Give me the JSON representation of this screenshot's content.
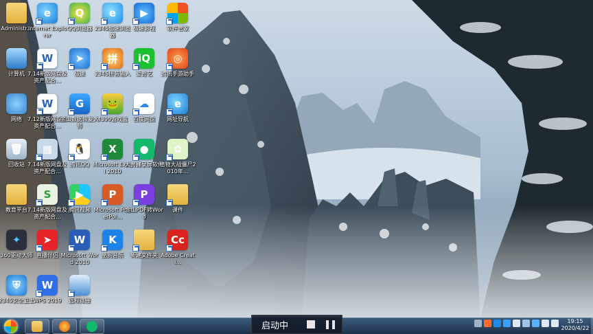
{
  "desktop": {
    "icons": [
      {
        "label": "Administr...",
        "glyph": "",
        "icon": "user-folder-icon",
        "cls": "c-folder"
      },
      {
        "label": "Internet Explorer",
        "glyph": "e",
        "icon": "internet-explorer-icon",
        "cls": "c-ie"
      },
      {
        "label": "QQ浏览器",
        "glyph": "Q",
        "icon": "qq-browser-icon",
        "cls": "c-qqbrowser"
      },
      {
        "label": "2345加速浏览器",
        "glyph": "e",
        "icon": "2345-browser-icon",
        "cls": "c-ie2345"
      },
      {
        "label": "极速影视",
        "glyph": "▶",
        "icon": "video-player-icon",
        "cls": "c-video"
      },
      {
        "label": "软件管家",
        "glyph": "",
        "icon": "software-manager-icon",
        "cls": "c-soft"
      },
      {
        "label": "计算机",
        "glyph": "",
        "icon": "computer-icon",
        "cls": "c-pc"
      },
      {
        "label": "7.14新版网盘及资产配合...",
        "glyph": "W",
        "icon": "word-document-icon",
        "cls": "c-doc"
      },
      {
        "label": "极速",
        "glyph": "➤",
        "icon": "jisu-icon",
        "cls": "c-jisu"
      },
      {
        "label": "2345拼音输入",
        "glyph": "拼",
        "icon": "pinyin-input-icon",
        "cls": "c-pinyin"
      },
      {
        "label": "爱奇艺",
        "glyph": "iQ",
        "icon": "iqiyi-icon",
        "cls": "c-iqiyi"
      },
      {
        "label": "腾讯手游助手",
        "glyph": "◎",
        "icon": "tencent-game-assistant-icon",
        "cls": "c-game"
      },
      {
        "label": "网络",
        "glyph": "",
        "icon": "network-icon",
        "cls": "c-net"
      },
      {
        "label": "7.12新版网盘及资产配合...",
        "glyph": "W",
        "icon": "word-document-icon",
        "cls": "c-doc"
      },
      {
        "label": "金山数据恢复大师",
        "glyph": "G",
        "icon": "jinshan-data-recovery-icon",
        "cls": "c-jinshan"
      },
      {
        "label": "4399游戏盒",
        "glyph": "🐸",
        "icon": "4399-game-box-icon",
        "cls": "c-4399"
      },
      {
        "label": "百度网盘",
        "glyph": "☁",
        "icon": "baidu-netdisk-icon",
        "cls": "c-baidu"
      },
      {
        "label": "网址导航",
        "glyph": "e",
        "icon": "web-navigation-icon",
        "cls": "c-ie"
      },
      {
        "label": "回收站",
        "glyph": "🗑",
        "icon": "recycle-bin-icon",
        "cls": "c-recycle"
      },
      {
        "label": "7.14新版网盘及资产配合...",
        "glyph": "▦",
        "icon": "presentation-file-icon",
        "cls": "c-ppt"
      },
      {
        "label": "腾讯QQ",
        "glyph": "🐧",
        "icon": "tencent-qq-icon",
        "cls": "c-qq"
      },
      {
        "label": "Microsoft Excel 2010",
        "glyph": "X",
        "icon": "excel-icon",
        "cls": "c-excel"
      },
      {
        "label": "大黄蜂录屏软件",
        "glyph": "●",
        "icon": "screen-recorder-icon",
        "cls": "c-lupin"
      },
      {
        "label": "植物大战僵尸2010年...",
        "glyph": "✿",
        "icon": "plants-vs-zombies-icon",
        "cls": "c-plant"
      },
      {
        "label": "教育平台",
        "glyph": "",
        "icon": "folder-icon",
        "cls": "c-edu"
      },
      {
        "label": "7.14新版网盘及资产配合...",
        "glyph": "S",
        "icon": "spreadsheet-file-icon",
        "cls": "c-class"
      },
      {
        "label": "腾讯视频",
        "glyph": "▶",
        "icon": "tencent-video-icon",
        "cls": "c-tencentv"
      },
      {
        "label": "Microsoft PowerPoi...",
        "glyph": "P",
        "icon": "powerpoint-icon",
        "cls": "c-pptx"
      },
      {
        "label": "金山PDF转Word",
        "glyph": "P",
        "icon": "pdf-to-word-icon",
        "cls": "c-pdf"
      },
      {
        "label": "课件",
        "glyph": "",
        "icon": "folder-icon",
        "cls": "c-folder"
      },
      {
        "label": "360驱动大师",
        "glyph": "✦",
        "icon": "360-driver-icon",
        "cls": "c-360"
      },
      {
        "label": "直播伴侣",
        "glyph": "➤",
        "icon": "live-companion-icon",
        "cls": "c-lure"
      },
      {
        "label": "Microsoft Word 2010",
        "glyph": "W",
        "icon": "word-icon",
        "cls": "c-word"
      },
      {
        "label": "酷狗音乐",
        "glyph": "K",
        "icon": "kugou-music-icon",
        "cls": "c-kugou"
      },
      {
        "label": "新建文件夹",
        "glyph": "",
        "icon": "new-folder-icon",
        "cls": "c-newfolder"
      },
      {
        "label": "Adobe Creati...",
        "glyph": "Cc",
        "icon": "adobe-creative-cloud-icon",
        "cls": "c-adobe"
      },
      {
        "label": "2345安全卫士",
        "glyph": "⛨",
        "icon": "2345-security-icon",
        "cls": "c-safe"
      },
      {
        "label": "WPS 2019",
        "glyph": "W",
        "icon": "wps-icon",
        "cls": "c-wps"
      },
      {
        "label": "远程连接",
        "glyph": "",
        "icon": "remote-desktop-icon",
        "cls": "c-remote"
      }
    ]
  },
  "taskbar": {
    "pinned": [
      {
        "icon": "file-explorer-icon",
        "cls": "g-explorer"
      },
      {
        "icon": "firefox-icon",
        "cls": "g-firefox"
      },
      {
        "icon": "screen-recorder-icon",
        "cls": "g-rec"
      }
    ],
    "recorder": {
      "status": "启动中"
    },
    "tray": [
      {
        "icon": "keyboard-icon",
        "color": "#9fb4c8"
      },
      {
        "icon": "browser-tray-icon",
        "color": "#ff6b2b"
      },
      {
        "icon": "security-tray-icon",
        "color": "#1e8be8"
      },
      {
        "icon": "shield-tray-icon",
        "color": "#3aa0ff"
      },
      {
        "icon": "network-tray-icon",
        "color": "#dfe9f3"
      },
      {
        "icon": "flag-tray-icon",
        "color": "#a0c4e8"
      },
      {
        "icon": "cloud-tray-icon",
        "color": "#58b0ff"
      },
      {
        "icon": "power-tray-icon",
        "color": "#dfe9f3"
      },
      {
        "icon": "volume-icon",
        "color": "#dfe9f3"
      }
    ],
    "clock": {
      "time": "19:15",
      "date": "2020/4/22"
    }
  }
}
